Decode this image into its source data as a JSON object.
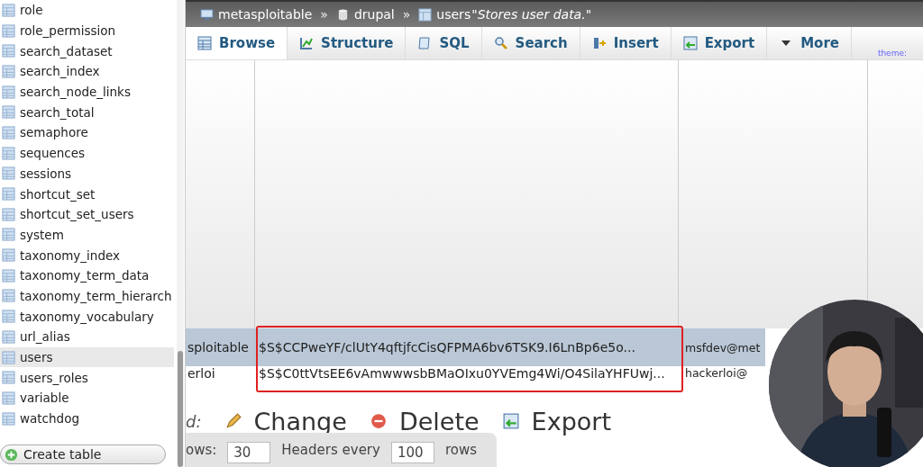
{
  "sidebar": {
    "items": [
      {
        "label": "role",
        "selected": false
      },
      {
        "label": "role_permission",
        "selected": false
      },
      {
        "label": "search_dataset",
        "selected": false
      },
      {
        "label": "search_index",
        "selected": false
      },
      {
        "label": "search_node_links",
        "selected": false
      },
      {
        "label": "search_total",
        "selected": false
      },
      {
        "label": "semaphore",
        "selected": false
      },
      {
        "label": "sequences",
        "selected": false
      },
      {
        "label": "sessions",
        "selected": false
      },
      {
        "label": "shortcut_set",
        "selected": false
      },
      {
        "label": "shortcut_set_users",
        "selected": false
      },
      {
        "label": "system",
        "selected": false
      },
      {
        "label": "taxonomy_index",
        "selected": false
      },
      {
        "label": "taxonomy_term_data",
        "selected": false
      },
      {
        "label": "taxonomy_term_hierarch",
        "selected": false
      },
      {
        "label": "taxonomy_vocabulary",
        "selected": false
      },
      {
        "label": "url_alias",
        "selected": false
      },
      {
        "label": "users",
        "selected": true
      },
      {
        "label": "users_roles",
        "selected": false
      },
      {
        "label": "variable",
        "selected": false
      },
      {
        "label": "watchdog",
        "selected": false
      }
    ],
    "create_button": "Create table"
  },
  "breadcrumb": {
    "server": "metasploitable",
    "separator_1": "»",
    "database": "drupal",
    "separator_2": "»",
    "table": "users",
    "comment": "\"Stores user data.\""
  },
  "tabs": [
    {
      "kind": "browse",
      "label": "Browse",
      "selected": true
    },
    {
      "kind": "structure",
      "label": "Structure",
      "selected": false
    },
    {
      "kind": "sql",
      "label": "SQL",
      "selected": false
    },
    {
      "kind": "search",
      "label": "Search",
      "selected": false
    },
    {
      "kind": "insert",
      "label": "Insert",
      "selected": false
    },
    {
      "kind": "export",
      "label": "Export",
      "selected": false
    },
    {
      "kind": "more",
      "label": "More",
      "selected": false
    }
  ],
  "theme_link": "theme:",
  "table": {
    "rows": [
      {
        "column_1": "sploitable",
        "column_2": "$S$CCPweYF/clUtY4qftjfcCisQFPMA6bv6TSK9.I6LnBp6e5o...",
        "column_3": "msfdev@met",
        "selected": true
      },
      {
        "column_1": "erloi",
        "column_2": "$S$C0ttVtsEE6vAmwwwsbBMaOIxu0YVEmg4Wi/O4SilaYHFUwj...",
        "column_3": "hackerloi@",
        "selected": false
      }
    ]
  },
  "actions_label": "d:",
  "actions": [
    {
      "kind": "change",
      "label": "Change"
    },
    {
      "kind": "delete",
      "label": "Delete"
    },
    {
      "kind": "export",
      "label": "Export"
    }
  ],
  "paging": {
    "rows_label": "ows:",
    "rows_value": "30",
    "headers_label": "Headers every",
    "headers_value": "100",
    "rows_suffix": "rows"
  }
}
